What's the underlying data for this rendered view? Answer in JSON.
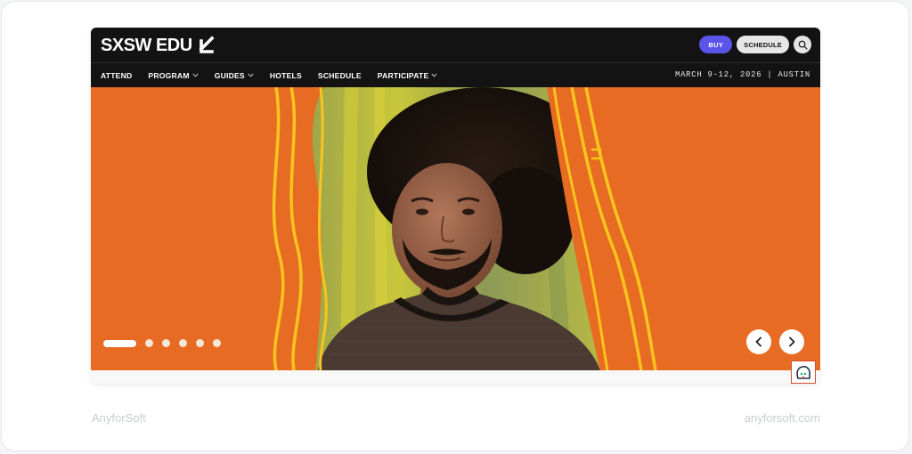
{
  "site": {
    "logo_text": "SXSW EDU",
    "logo_icon": "arrow-down-left-icon",
    "buttons": {
      "buy_label": "BUY",
      "schedule_label": "SCHEDULE",
      "search_icon": "search-icon"
    },
    "nav": {
      "items": [
        {
          "label": "ATTEND",
          "has_dropdown": false
        },
        {
          "label": "PROGRAM",
          "has_dropdown": true
        },
        {
          "label": "GUIDES",
          "has_dropdown": true
        },
        {
          "label": "HOTELS",
          "has_dropdown": false
        },
        {
          "label": "SCHEDULE",
          "has_dropdown": false
        },
        {
          "label": "PARTICIPATE",
          "has_dropdown": true
        }
      ],
      "event_date": "MARCH 9-12, 2026 | AUSTIN"
    },
    "hero": {
      "slide_count": 6,
      "active_slide": 1,
      "prev_icon": "chevron-left-icon",
      "next_icon": "chevron-right-icon"
    },
    "chat_widget_icon": "chat-bot-icon"
  },
  "footer": {
    "left_text": "AnyforSoft",
    "right_text": "anyforsoft.com"
  },
  "colors": {
    "header_bg": "#131313",
    "hero_orange": "#e76b22",
    "accent_yellow": "#f7c51e",
    "buy_purple": "#5a55e8"
  }
}
